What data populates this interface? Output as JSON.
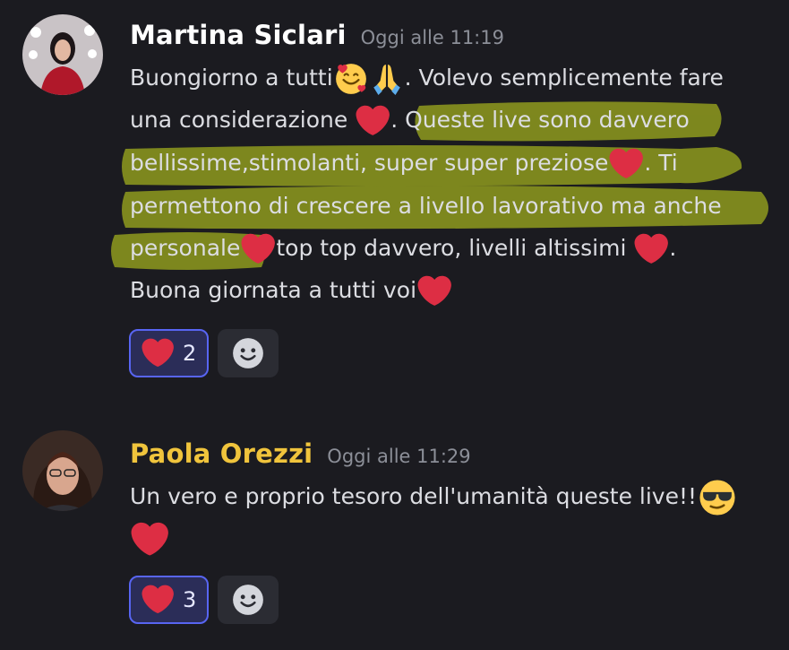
{
  "messages": [
    {
      "author": "Martina Siclari",
      "author_color": "#ffffff",
      "timestamp": "Oggi alle 11:19",
      "lines": [
        {
          "a": "Buongiorno a tutti",
          "b": ". Volevo semplicemente fare"
        },
        {
          "a": "una considerazione ",
          "b": ". Queste live sono davvero"
        },
        {
          "a": "bellissime,stimolanti,  super super preziose",
          "b": ". Ti"
        },
        {
          "a": "permettono di crescere a livello lavorativo ma anche"
        },
        {
          "a": "personale",
          "b": "top top davvero, livelli altissimi ",
          "c": "."
        },
        {
          "a": "Buona giornata a tutti voi"
        }
      ],
      "reaction": {
        "emoji": "heart-icon",
        "count": "2"
      }
    },
    {
      "author": "Paola Orezzi",
      "author_color": "#f0c43c",
      "timestamp": "Oggi alle 11:29",
      "lines": [
        {
          "a": "Un vero e proprio tesoro dell'umanità queste live!!"
        }
      ],
      "reaction": {
        "emoji": "heart-icon",
        "count": "3"
      }
    }
  ],
  "colors": {
    "background": "#1b1b20",
    "highlight": "#8f9a1e",
    "reaction_border": "#5865f2",
    "heart": "#dd2e44"
  }
}
